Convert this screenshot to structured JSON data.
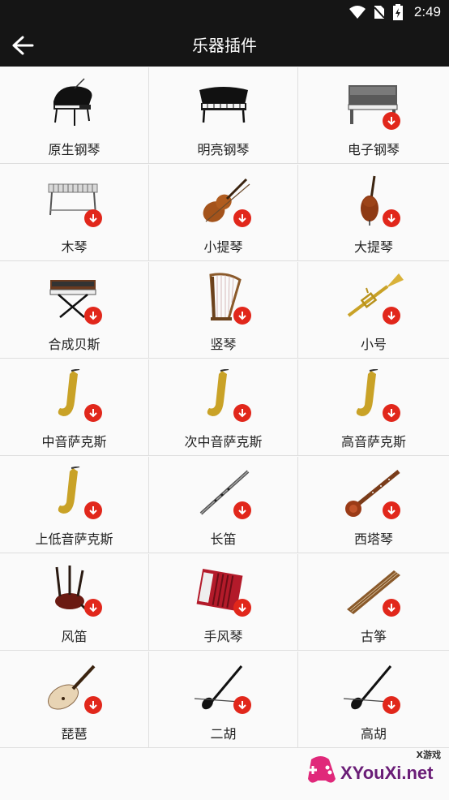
{
  "status_bar": {
    "time": "2:49"
  },
  "app_bar": {
    "title": "乐器插件"
  },
  "instruments": [
    {
      "label": "原生钢琴",
      "icon": "grand-piano-icon",
      "download": false
    },
    {
      "label": "明亮钢琴",
      "icon": "bright-piano-icon",
      "download": false
    },
    {
      "label": "电子钢琴",
      "icon": "electric-piano-icon",
      "download": true
    },
    {
      "label": "木琴",
      "icon": "xylophone-icon",
      "download": true
    },
    {
      "label": "小提琴",
      "icon": "violin-icon",
      "download": true
    },
    {
      "label": "大提琴",
      "icon": "cello-icon",
      "download": true
    },
    {
      "label": "合成贝斯",
      "icon": "synth-bass-icon",
      "download": true
    },
    {
      "label": "竖琴",
      "icon": "harp-icon",
      "download": true
    },
    {
      "label": "小号",
      "icon": "trumpet-icon",
      "download": true
    },
    {
      "label": "中音萨克斯",
      "icon": "alto-sax-icon",
      "download": true
    },
    {
      "label": "次中音萨克斯",
      "icon": "tenor-sax-icon",
      "download": true
    },
    {
      "label": "高音萨克斯",
      "icon": "soprano-sax-icon",
      "download": true
    },
    {
      "label": "上低音萨克斯",
      "icon": "baritone-sax-icon",
      "download": true
    },
    {
      "label": "长笛",
      "icon": "flute-icon",
      "download": true
    },
    {
      "label": "西塔琴",
      "icon": "sitar-icon",
      "download": true
    },
    {
      "label": "风笛",
      "icon": "bagpipe-icon",
      "download": true
    },
    {
      "label": "手风琴",
      "icon": "accordion-icon",
      "download": true
    },
    {
      "label": "古筝",
      "icon": "guzheng-icon",
      "download": true
    },
    {
      "label": "琵琶",
      "icon": "pipa-icon",
      "download": true
    },
    {
      "label": "二胡",
      "icon": "erhu-icon",
      "download": true
    },
    {
      "label": "高胡",
      "icon": "gaohu-icon",
      "download": true
    }
  ],
  "watermark": {
    "text": "XYouXi.net",
    "small": "X游戏"
  },
  "colors": {
    "app_bar": "#151515",
    "download_badge": "#e1271b",
    "background": "#fafafa"
  }
}
